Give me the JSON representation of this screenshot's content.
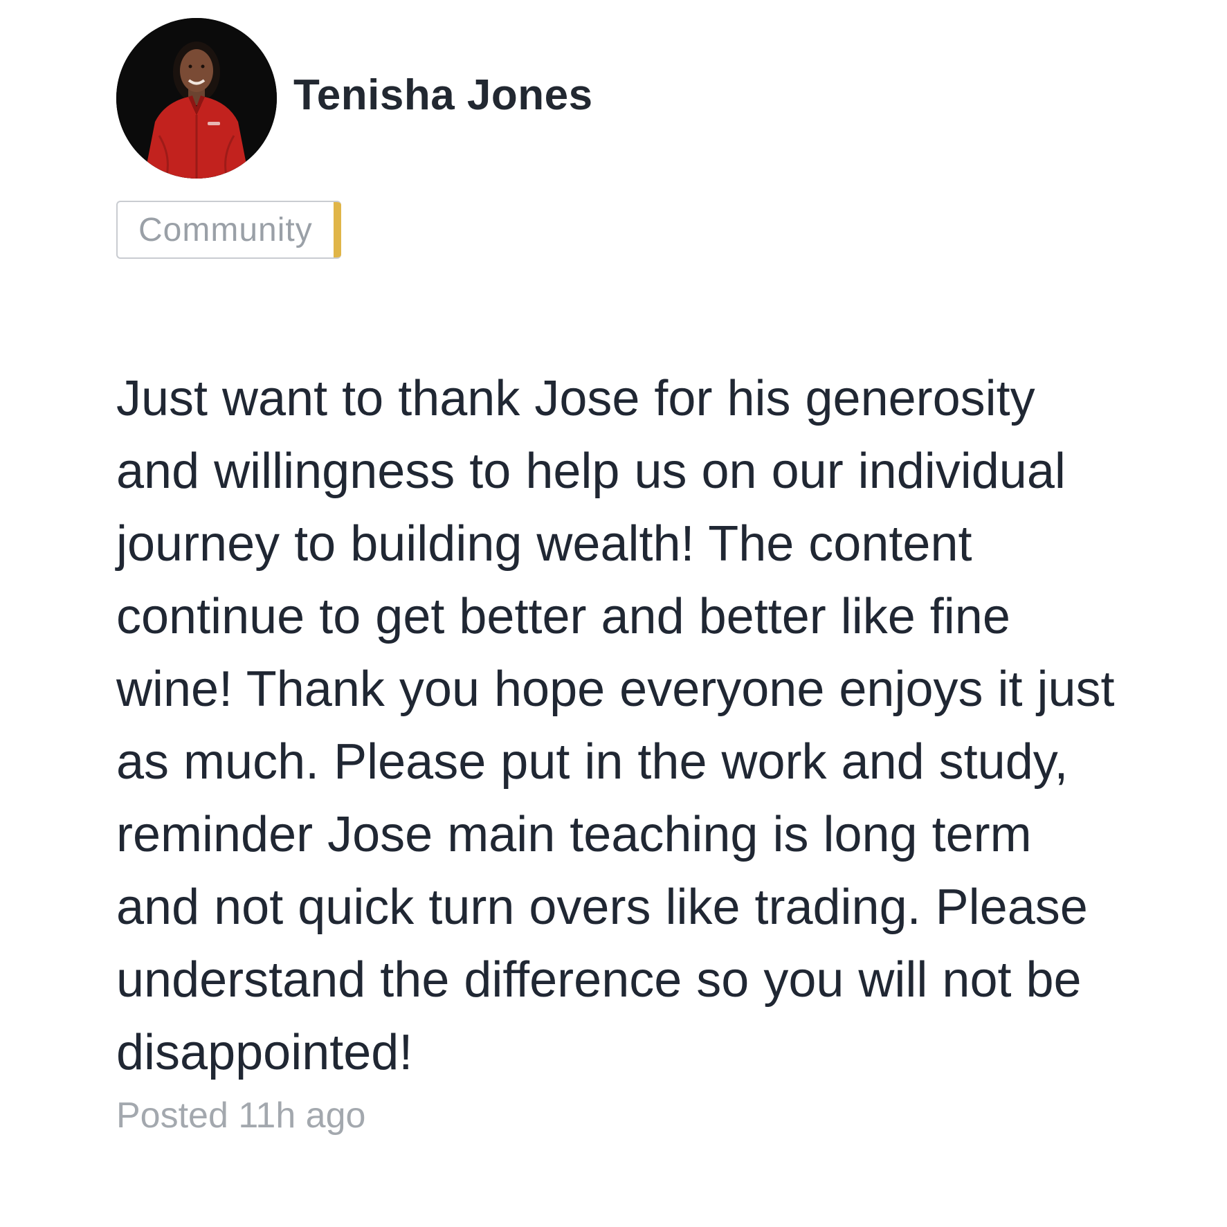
{
  "post": {
    "author": {
      "name": "Tenisha Jones",
      "avatar_icon": "profile-photo"
    },
    "tag": {
      "label": "Community",
      "accent_color": "#e0b548"
    },
    "body": "Just want to thank Jose for his generosity and willingness to help us on our individual journey to building wealth! The content continue to get better and better like fine wine! Thank you hope everyone enjoys it just as much. Please put in the work and study, reminder Jose main teaching is long term and not quick turn overs like trading. Please understand the difference so you will not be disappointed!",
    "meta": {
      "posted": "Posted 11h ago"
    }
  }
}
